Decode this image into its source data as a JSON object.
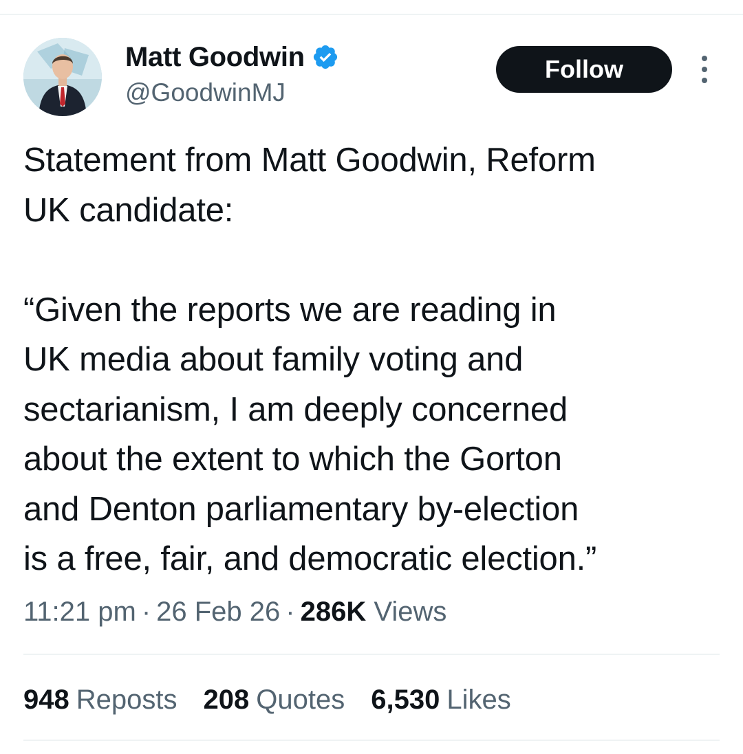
{
  "author": {
    "display_name": "Matt Goodwin",
    "handle": "@GoodwinMJ",
    "verified": true,
    "verified_icon": "verified-badge-icon",
    "avatar_icon": "profile-photo"
  },
  "actions": {
    "follow_label": "Follow",
    "more_icon": "vertical-ellipsis-icon"
  },
  "tweet": {
    "text": "Statement from Matt Goodwin, Reform\nUK candidate:\n\n“Given the reports we are reading in\nUK media about family voting and\nsectarianism, I am deeply concerned\nabout the extent to which the Gorton\nand Denton parliamentary by-election\nis a free, fair, and democratic election.”"
  },
  "meta": {
    "time": "11:21 pm",
    "separator": "·",
    "date": "26 Feb 26",
    "views_count": "286K",
    "views_label": "Views"
  },
  "stats": {
    "reposts_count": "948",
    "reposts_label": "Reposts",
    "quotes_count": "208",
    "quotes_label": "Quotes",
    "likes_count": "6,530",
    "likes_label": "Likes"
  },
  "colors": {
    "text_primary": "#0f1419",
    "text_secondary": "#536471",
    "verified_blue": "#1d9bf0",
    "divider": "#eff3f4",
    "follow_bg": "#0f1419"
  }
}
